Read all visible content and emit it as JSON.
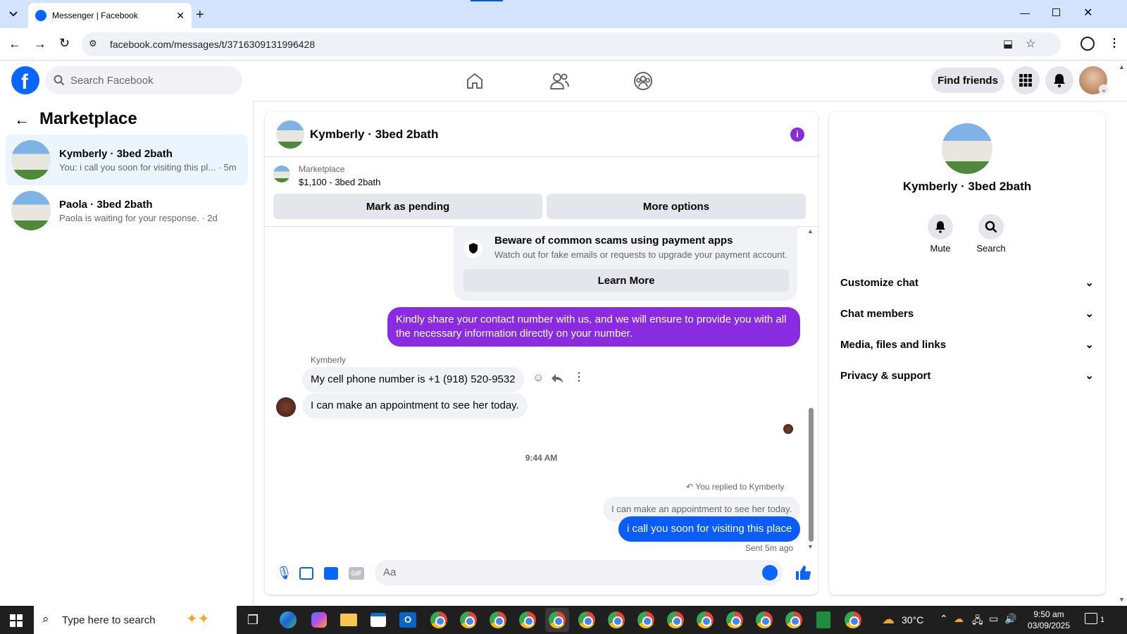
{
  "browser": {
    "tab_title": "Messenger | Facebook",
    "url": "facebook.com/messages/t/3716309131996428"
  },
  "fb_header": {
    "search_placeholder": "Search Facebook",
    "find_friends": "Find friends"
  },
  "left": {
    "title": "Marketplace",
    "conversations": [
      {
        "name": "Kymberly · 3bed 2bath",
        "preview": "You: i call you soon for visiting this pl... · 5m",
        "active": true
      },
      {
        "name": "Paola · 3bed 2bath",
        "preview": "Paola is waiting for your response. · 2d",
        "active": false
      }
    ]
  },
  "chat": {
    "title": "Kymberly · 3bed 2bath",
    "listing_label": "Marketplace",
    "listing_price": "$1,100 - 3bed 2bath",
    "mark_pending": "Mark as pending",
    "more_options": "More options",
    "scam_title": "Beware of common scams using payment apps",
    "scam_text": "Watch out for fake emails or requests to upgrade your payment account.",
    "learn_more": "Learn More",
    "msg_outgoing_1": "Kindly share your contact number with us, and we will ensure to provide you with all the necessary information directly on your number.",
    "sender_name": "Kymberly",
    "msg_in_1": "My cell phone number is +1 (918) 520-9532",
    "msg_in_2": "I can make an appointment to see her today.",
    "timestamp": "9:44 AM",
    "replied_label": "You replied to Kymberly",
    "quoted": "I can make an appointment to see her today.",
    "msg_outgoing_2": "i call you soon for visiting this place",
    "sent_status": "Sent 5m ago",
    "composer_placeholder": "Aa"
  },
  "right": {
    "name": "Kymberly · 3bed 2bath",
    "mute": "Mute",
    "search": "Search",
    "sections": [
      "Customize chat",
      "Chat members",
      "Media, files and links",
      "Privacy & support"
    ]
  },
  "taskbar": {
    "search_placeholder": "Type here to search",
    "temperature": "30°C",
    "time": "9:50 am",
    "date": "03/09/2025",
    "notif_count": "1"
  },
  "colors": {
    "fb_blue": "#0866ff",
    "messenger_purple": "#8a2be2",
    "outgoing_blue": "#0a5cff"
  }
}
